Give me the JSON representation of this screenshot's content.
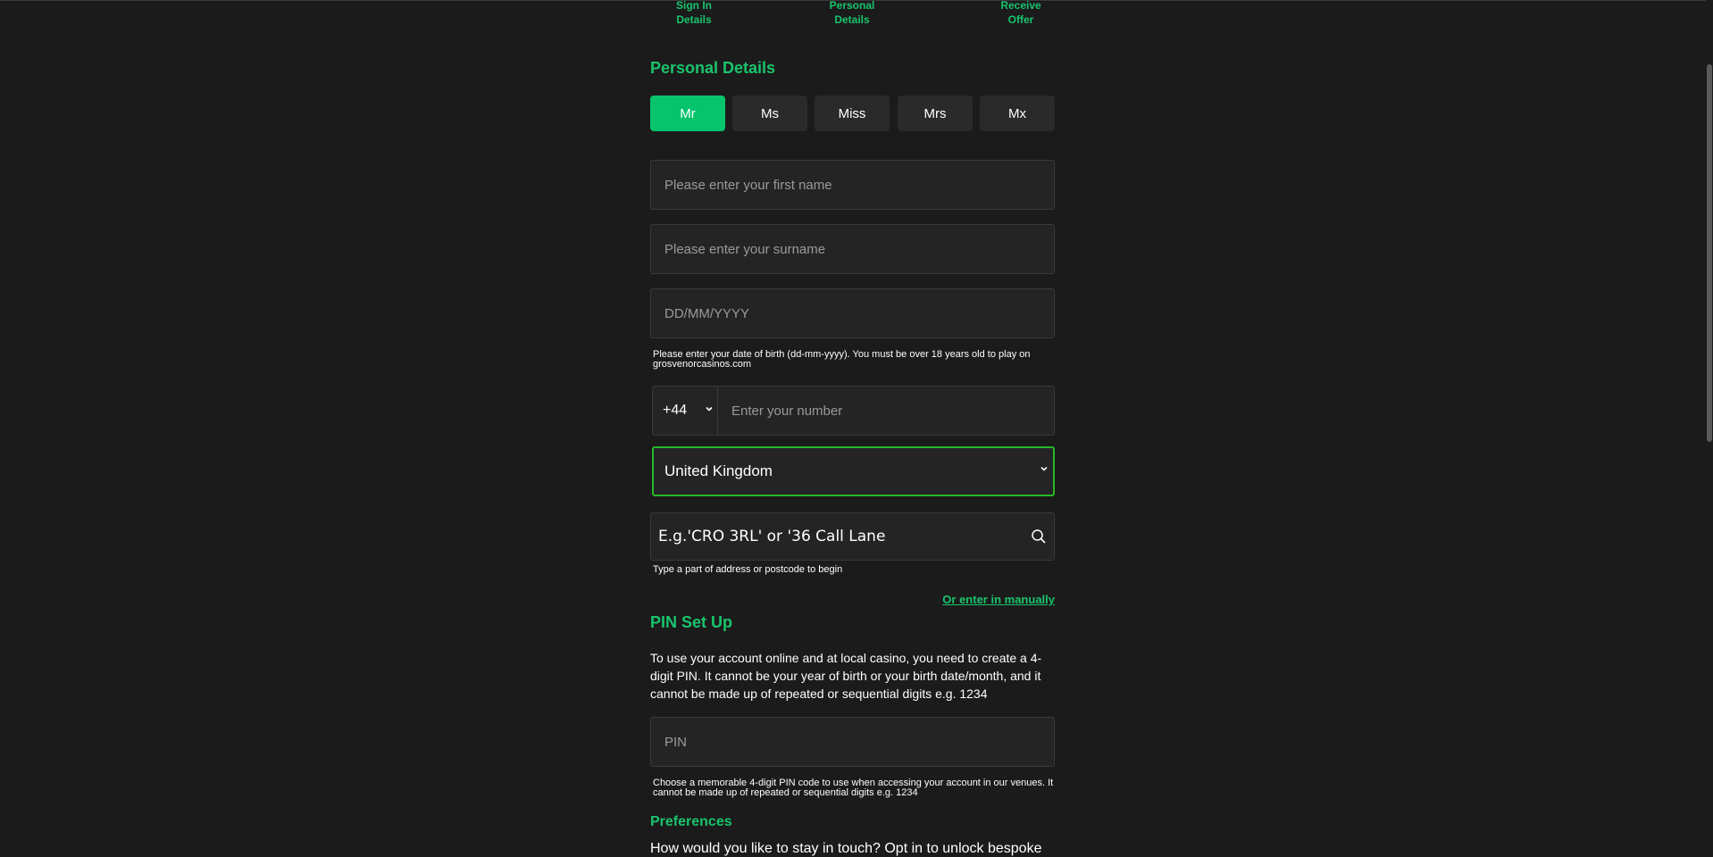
{
  "steps": [
    {
      "label_l1": "Sign In",
      "label_l2": "Details"
    },
    {
      "label_l1": "Personal",
      "label_l2": "Details"
    },
    {
      "label_l1": "Receive",
      "label_l2": "Offer"
    }
  ],
  "personal": {
    "title": "Personal Details",
    "titles": [
      "Mr",
      "Ms",
      "Miss",
      "Mrs",
      "Mx"
    ],
    "selected_title": "Mr",
    "first_name_placeholder": "Please enter your first name",
    "surname_placeholder": "Please enter your surname",
    "dob_placeholder": "DD/MM/YYYY",
    "dob_hint": "Please enter your date of birth (dd-mm-yyyy). You must be over 18 years old to play on grosvenorcasinos.com",
    "phone_code": "+44",
    "phone_placeholder": "Enter your number",
    "country": "United Kingdom",
    "address_placeholder": "E.g.'CRO 3RL' or '36 Call Lane",
    "address_hint": "Type a part of address or postcode to begin",
    "manual_link": "Or enter in manually"
  },
  "pin": {
    "title": "PIN Set Up",
    "description": "To use your account online and at local casino, you need to create a 4-digit PIN. It cannot be your year of birth or your birth date/month, and it cannot be made up of repeated or sequential digits e.g. 1234",
    "placeholder": "PIN",
    "hint": "Choose a memorable 4-digit PIN code to use when accessing your account in our venues. It cannot be made up of repeated or sequential digits e.g. 1234"
  },
  "preferences": {
    "title": "Preferences",
    "text": "How would you like to stay in touch? Opt in to unlock bespoke"
  },
  "colors": {
    "accent": "#19c46c",
    "background": "#1b1b1b",
    "field": "#242424",
    "active_border": "#25b829"
  },
  "icons": {
    "search": "search-icon",
    "chevron": "chevron-down-icon"
  }
}
